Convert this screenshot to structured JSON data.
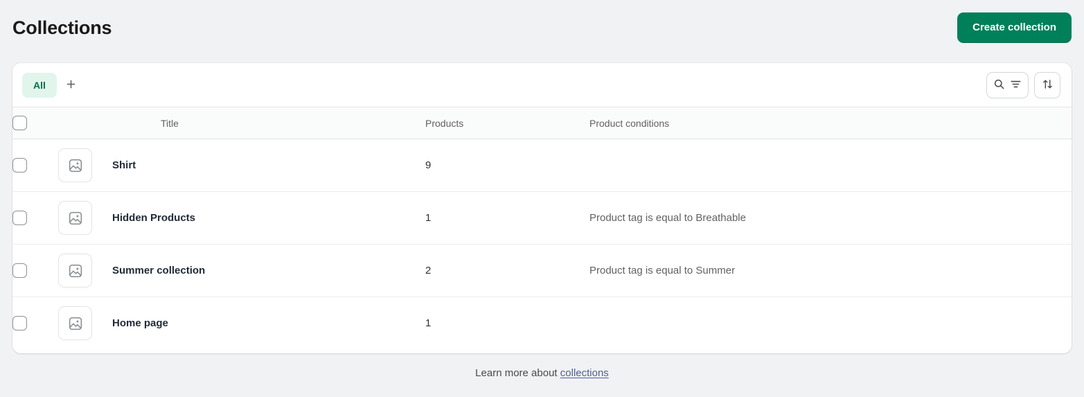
{
  "header": {
    "title": "Collections",
    "create_button": "Create collection"
  },
  "toolbar": {
    "tabs": [
      {
        "label": "All",
        "selected": true
      }
    ],
    "add_tab_icon": "plus-icon",
    "search_filter_icon": "search-filter-icon",
    "sort_icon": "sort-arrows-icon"
  },
  "table": {
    "columns": {
      "title": "Title",
      "products": "Products",
      "conditions": "Product conditions"
    },
    "rows": [
      {
        "title": "Shirt",
        "products": "9",
        "conditions": "",
        "thumbnail_icon": "image-placeholder-icon",
        "selected": false
      },
      {
        "title": "Hidden Products",
        "products": "1",
        "conditions": "Product tag is equal to Breathable",
        "thumbnail_icon": "image-placeholder-icon",
        "selected": false
      },
      {
        "title": "Summer collection",
        "products": "2",
        "conditions": "Product tag is equal to Summer",
        "thumbnail_icon": "image-placeholder-icon",
        "selected": false
      },
      {
        "title": "Home page",
        "products": "1",
        "conditions": "",
        "thumbnail_icon": "image-placeholder-icon",
        "selected": false
      }
    ]
  },
  "footer": {
    "text": "Learn more about",
    "link_label": "collections"
  },
  "colors": {
    "page_background": "#f1f2f4",
    "card_background": "#ffffff",
    "primary_green": "#00805a",
    "tab_selected_background": "#e1f5ec",
    "tab_selected_text": "#0b6b4f",
    "link": "#4f5f93",
    "muted_text": "#616161"
  }
}
